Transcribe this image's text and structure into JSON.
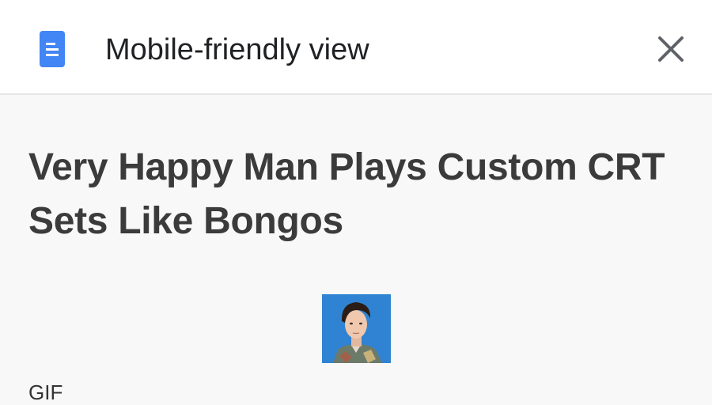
{
  "header": {
    "icon": "document-icon",
    "title": "Mobile-friendly view",
    "close_icon": "close-icon",
    "accent_color": "#4285f4"
  },
  "article": {
    "title": "Very Happy Man Plays Custom CRT Sets Like Bongos",
    "image_icon": "author-photo",
    "media_label": "GIF"
  }
}
